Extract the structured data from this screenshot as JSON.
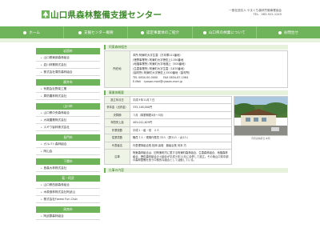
{
  "header": {
    "title": "山口県森林整備支援センター",
    "right_line1": "一般社団法人 やまぐち森林労働事業協会",
    "right_line2": "TEL：083-922-1245"
  },
  "nav": [
    {
      "label": "ホーム",
      "name": "nav-home"
    },
    {
      "label": "支援センター概要",
      "name": "nav-center-overview"
    },
    {
      "label": "認定事業体のご紹介",
      "name": "nav-certified-entities"
    },
    {
      "label": "山口県の林業について",
      "name": "nav-yamaguchi-forestry"
    },
    {
      "label": "お問合せ",
      "name": "nav-contact"
    }
  ],
  "sidebar": [
    {
      "head": "岩国市",
      "items": [
        "山口県東部森林組合",
        "岩川林業株式会社",
        "株式会社周防森林組合"
      ]
    },
    {
      "head": "柳井市",
      "items": [
        "有限会社野菜工業",
        "周防農林株式会社"
      ]
    },
    {
      "head": "山口市",
      "items": [
        "山口県中央森林組合",
        "大城農業株式会社",
        "スギウ製林株式会社"
      ]
    },
    {
      "head": "長門市",
      "items": [
        "ガルバト森林組合",
        "阿山会"
      ]
    },
    {
      "head": "下関市",
      "items": [
        "島森大林株式会社"
      ]
    },
    {
      "head": "萩・阿武",
      "items": [
        "山口県西部森林組合",
        "木原造林株式会社阿武山",
        "株式会社Forest Fun Club"
      ]
    },
    {
      "head": "周南市",
      "items": [
        "阿武郡森林組合"
      ]
    }
  ],
  "address": {
    "section": "阿東森林組合",
    "label": "所在地",
    "lines": [
      "本所 阿東町大字生雲（万本郷111番地）",
      "(徳野事業所) 阿東町大字徳佐上1150番地",
      "(地福事業所) 阿東町大字地福上（500番地）",
      "(生雲事業所) 阿東町大字生雲（1870番地）",
      "(製材所) 阿東町大字徳佐上1500番地（製材所）",
      "TEL 0834-00-0000　　FAX 0834-87-1564",
      "E-Mail　ryosan-mori@ryosan-mori.jp"
    ]
  },
  "overview": {
    "section": "事業体概要",
    "rows": [
      {
        "label": "設立年月日",
        "value": "平成９年11月７日"
      },
      {
        "label": "資本金（出資金）",
        "value": "335,148,000円"
      },
      {
        "label": "決算期",
        "value": "３月（事業期間4月～3月）"
      },
      {
        "label": "年間売上高",
        "value": "405,012,629円"
      },
      {
        "label": "作業班数",
        "value": "平成１・組・班　２人"
      },
      {
        "label": "従業員数",
        "value": "職員７人・現場作業員 33人（男31人・女2人）"
      },
      {
        "label": "代表者名",
        "value": "代表理事組合長 松岡 喜雄　副組合長 河本 巧"
      },
      {
        "label": "沿革",
        "value": "阿東森林組合は、旧阿東町内に属する阿東町森林組合、生雲森林組合、地福森林組合、徳佐森林組合の４組合が平成９年11月に合併して設立。その後山口県中部の森林整備を担う中核的な組合として活動している。"
      }
    ],
    "photo_caption": "阿東森林組合 本所"
  },
  "bottom_section": "仕事の内容",
  "colors": {
    "accent": "#6fb35a",
    "title": "#3d8a2a"
  }
}
